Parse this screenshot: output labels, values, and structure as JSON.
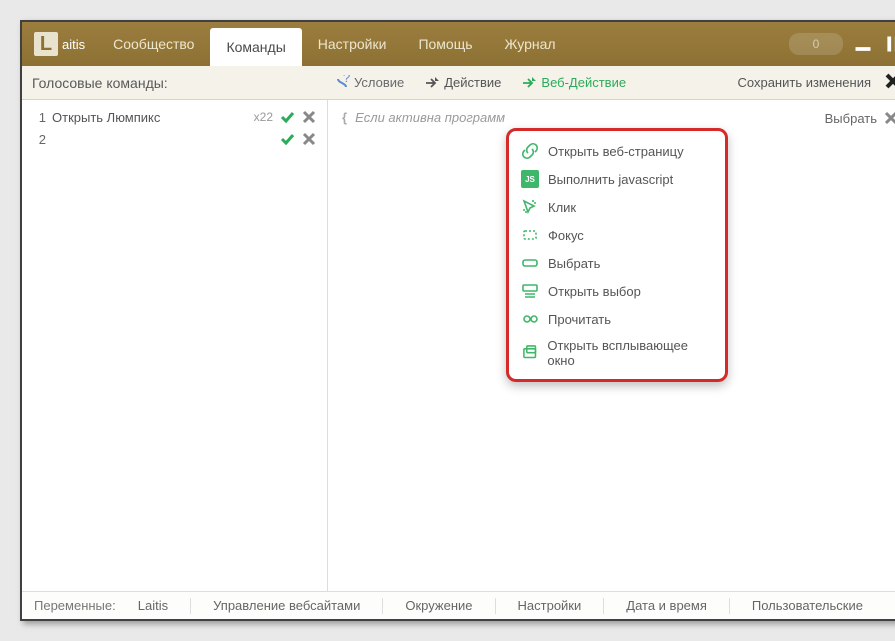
{
  "app": {
    "name": "aitis",
    "logo_letter": "L"
  },
  "tabs": [
    "Сообщество",
    "Команды",
    "Настройки",
    "Помощь",
    "Журнал"
  ],
  "active_tab": 1,
  "counter": "0",
  "voice_title": "Голосовые команды:",
  "toolbar": {
    "condition": "Условие",
    "action": "Действие",
    "web_action": "Веб-Действие",
    "save": "Сохранить изменения"
  },
  "commands": [
    {
      "n": "1",
      "label": "Открыть Люмпикс",
      "count": "x22"
    },
    {
      "n": "2",
      "label": "",
      "count": ""
    }
  ],
  "cond_placeholder": "Если активна программ",
  "choose_label": "Выбрать",
  "menu": {
    "items": [
      "Открыть веб-страницу",
      "Выполнить javascript",
      "Клик",
      "Фокус",
      "Выбрать",
      "Открыть выбор",
      "Прочитать",
      "Открыть всплывающее окно"
    ],
    "icons": [
      "link",
      "js",
      "cursor",
      "focus",
      "select",
      "openselect",
      "read",
      "popup"
    ]
  },
  "status": {
    "label": "Переменные:",
    "items": [
      "Laitis",
      "Управление вебсайтами",
      "Окружение",
      "Настройки",
      "Дата и время",
      "Пользовательские"
    ]
  }
}
